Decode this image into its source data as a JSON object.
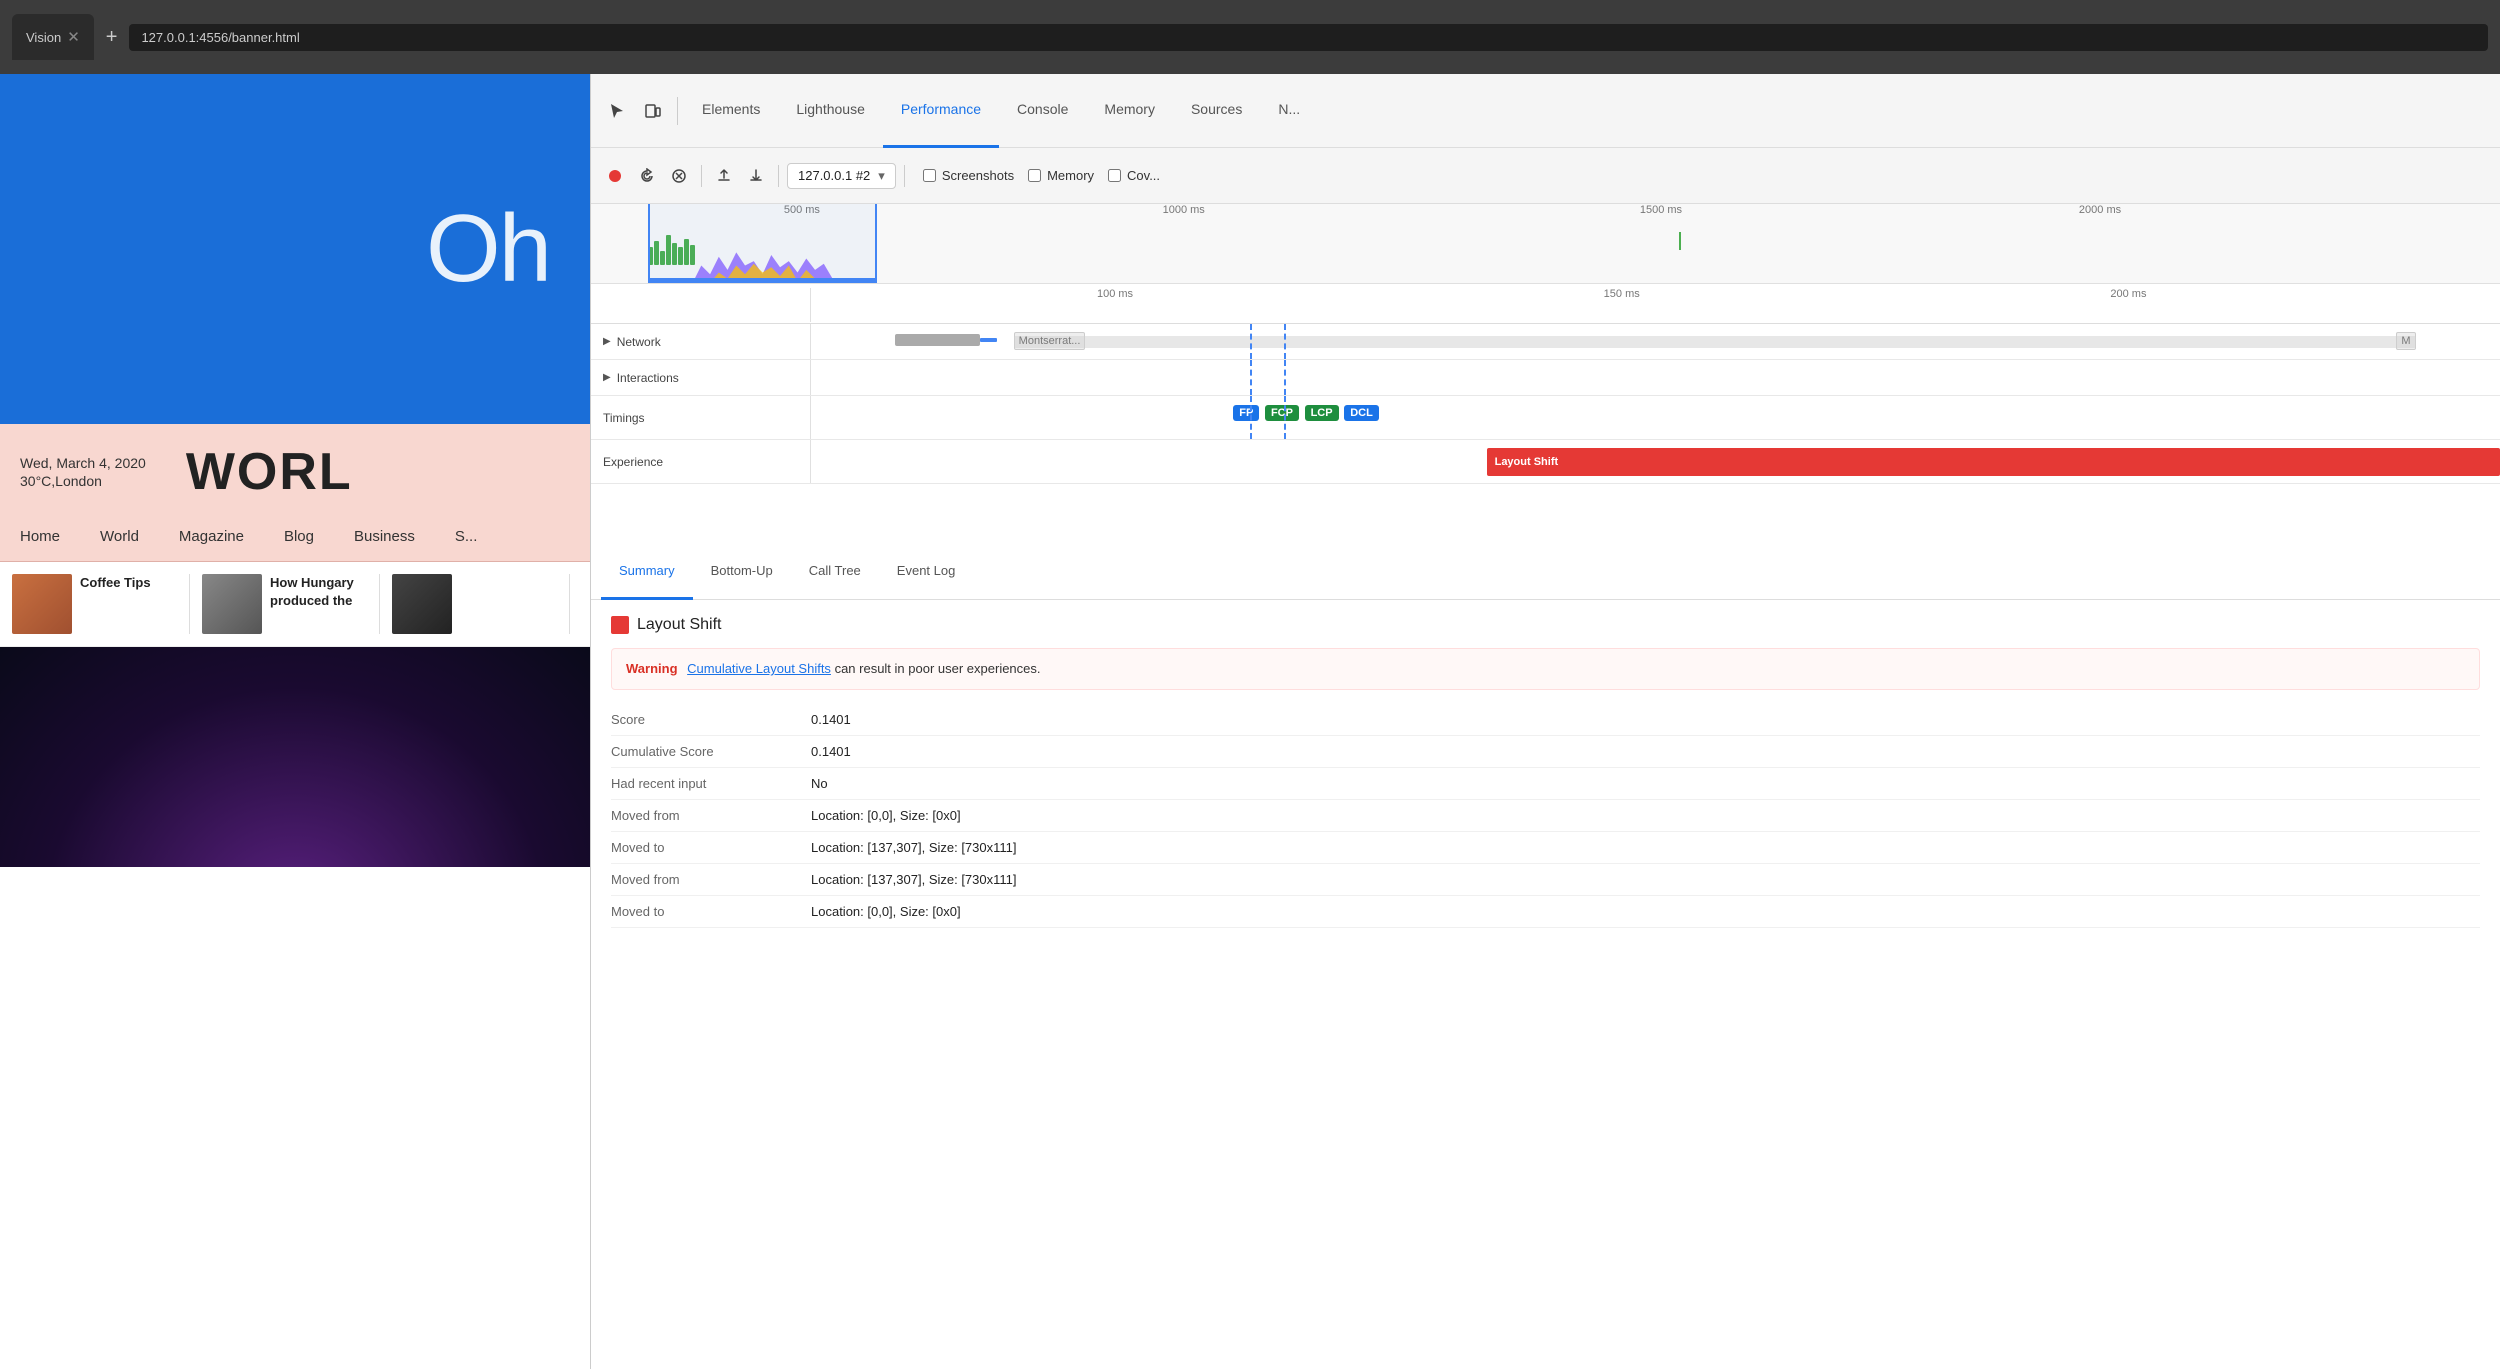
{
  "browser": {
    "tab_title": "Vision",
    "address": "127.0.0.1:4556/banner.html",
    "new_tab_label": "+"
  },
  "devtools": {
    "tabs": [
      {
        "id": "elements",
        "label": "Elements",
        "active": false
      },
      {
        "id": "lighthouse",
        "label": "Lighthouse",
        "active": false
      },
      {
        "id": "performance",
        "label": "Performance",
        "active": true
      },
      {
        "id": "console",
        "label": "Console",
        "active": false
      },
      {
        "id": "memory",
        "label": "Memory",
        "active": false
      },
      {
        "id": "sources",
        "label": "Sources",
        "active": false
      },
      {
        "id": "network",
        "label": "N...",
        "active": false
      }
    ],
    "toolbar": {
      "profile_label": "127.0.0.1 #2",
      "screenshots_label": "Screenshots",
      "memory_label": "Memory",
      "coverage_label": "Cov..."
    },
    "timeline": {
      "markers": [
        "500 ms",
        "1000 ms",
        "1500 ms",
        "2000 ms"
      ],
      "detail_markers": [
        "100 ms",
        "150 ms",
        "200 ms"
      ]
    },
    "tracks": [
      {
        "id": "network",
        "label": "Network",
        "expanded": false
      },
      {
        "id": "interactions",
        "label": "Interactions",
        "expanded": false
      },
      {
        "id": "timings",
        "label": "Timings",
        "badges": [
          "FP",
          "FCP",
          "LCP",
          "DCL"
        ]
      },
      {
        "id": "experience",
        "label": "Experience",
        "has_layout_shift": true
      }
    ],
    "network_item": "Montserrat...",
    "network_item_right": "M",
    "bottom_tabs": [
      {
        "id": "summary",
        "label": "Summary",
        "active": true
      },
      {
        "id": "bottom-up",
        "label": "Bottom-Up",
        "active": false
      },
      {
        "id": "call-tree",
        "label": "Call Tree",
        "active": false
      },
      {
        "id": "event-log",
        "label": "Event Log",
        "active": false
      }
    ],
    "details": {
      "header": "Layout Shift",
      "warning_label": "Warning",
      "warning_link_text": "Cumulative Layout Shifts",
      "warning_text": "can result in poor user experiences.",
      "rows": [
        {
          "label": "Score",
          "value": "0.1401"
        },
        {
          "label": "Cumulative Score",
          "value": "0.1401"
        },
        {
          "label": "Had recent input",
          "value": "No"
        },
        {
          "label": "Moved from",
          "value": "Location: [0,0], Size: [0x0]"
        },
        {
          "label": "Moved to",
          "value": "Location: [137,307], Size: [730x111]"
        },
        {
          "label": "Moved from",
          "value": "Location: [137,307], Size: [730x111]"
        },
        {
          "label": "Moved to",
          "value": "Location: [0,0], Size: [0x0]"
        }
      ]
    }
  },
  "webpage": {
    "banner_text": "Oh",
    "date": "Wed, March 4, 2020",
    "weather": "30°C,London",
    "world_title": "WORL",
    "nav_items": [
      "Home",
      "World",
      "Magazine",
      "Blog",
      "Business",
      "S..."
    ],
    "articles": [
      {
        "title": "Coffee Tips"
      },
      {
        "title": "How Hungary produced the"
      }
    ]
  }
}
